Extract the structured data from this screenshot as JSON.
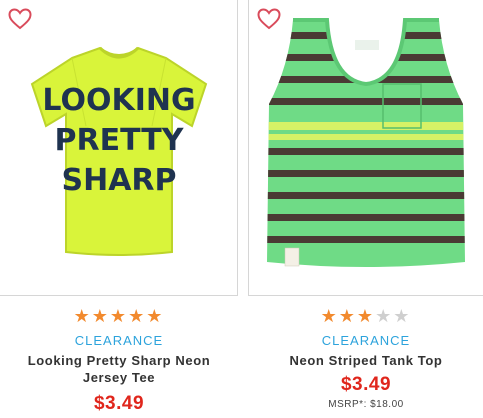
{
  "colors": {
    "accent_clearance": "#2da3dc",
    "price_red": "#e0261c",
    "star_orange": "#f28a2e",
    "heart_red": "#d94b5b"
  },
  "products": [
    {
      "image_text": "LOOKING PRETTY SHARP",
      "rating": 5,
      "rating_max": 5,
      "badge": "CLEARANCE",
      "name": "Looking Pretty Sharp Neon Jersey Tee",
      "price": "$3.49",
      "favorite_icon": "heart-outline-icon"
    },
    {
      "image_tag_text": "carter's",
      "rating": 3,
      "rating_max": 5,
      "badge": "CLEARANCE",
      "name": "Neon Striped Tank Top",
      "price": "$3.49",
      "msrp": "MSRP*: $18.00",
      "favorite_icon": "heart-outline-icon"
    }
  ]
}
